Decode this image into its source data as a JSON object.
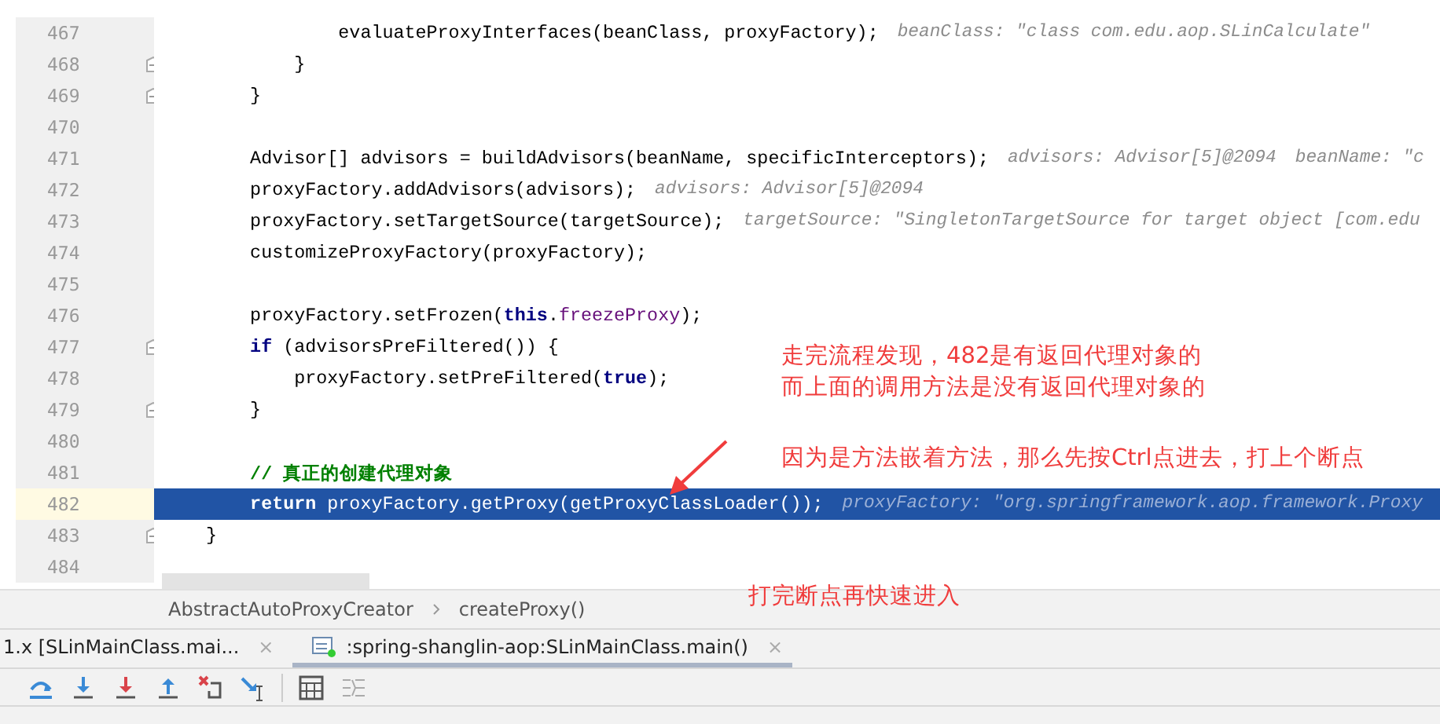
{
  "code_lines": [
    {
      "number": "467",
      "fold": false,
      "selected": false,
      "tokens": [
        {
          "text": "            evaluateProxyInterfaces(beanClass, proxyFactory);",
          "kind": "plain"
        }
      ],
      "hints": [
        "beanClass: \"class com.edu.aop.SLinCalculate\""
      ]
    },
    {
      "number": "468",
      "fold": true,
      "selected": false,
      "tokens": [
        {
          "text": "        }",
          "kind": "plain"
        }
      ]
    },
    {
      "number": "469",
      "fold": true,
      "selected": false,
      "tokens": [
        {
          "text": "    }",
          "kind": "plain"
        }
      ]
    },
    {
      "number": "470",
      "fold": false,
      "selected": false
    },
    {
      "number": "471",
      "fold": false,
      "selected": false,
      "tokens": [
        {
          "text": "    Advisor[] advisors = buildAdvisors(beanName, specificInterceptors);",
          "kind": "plain"
        }
      ],
      "hints": [
        "advisors: Advisor[5]@2094",
        "beanName: \"c"
      ]
    },
    {
      "number": "472",
      "fold": false,
      "selected": false,
      "tokens": [
        {
          "text": "    proxyFactory.addAdvisors(advisors);",
          "kind": "plain"
        }
      ],
      "hints": [
        "advisors: Advisor[5]@2094"
      ]
    },
    {
      "number": "473",
      "fold": false,
      "selected": false,
      "tokens": [
        {
          "text": "    proxyFactory.setTargetSource(targetSource);",
          "kind": "plain"
        }
      ],
      "hints": [
        "targetSource: \"SingletonTargetSource for target object [com.edu"
      ]
    },
    {
      "number": "474",
      "fold": false,
      "selected": false,
      "tokens": [
        {
          "text": "    customizeProxyFactory(proxyFactory);",
          "kind": "plain"
        }
      ]
    },
    {
      "number": "475",
      "fold": false,
      "selected": false
    },
    {
      "number": "476",
      "fold": false,
      "selected": false,
      "tokens": [
        {
          "text": "    proxyFactory.setFrozen(",
          "kind": "plain"
        },
        {
          "text": "this",
          "kind": "keyword"
        },
        {
          "text": ".",
          "kind": "plain"
        },
        {
          "text": "freezeProxy",
          "kind": "field"
        },
        {
          "text": ");",
          "kind": "plain"
        }
      ]
    },
    {
      "number": "477",
      "fold": true,
      "selected": false,
      "tokens": [
        {
          "text": "    if",
          "kind": "keyword"
        },
        {
          "text": " (advisorsPreFiltered()) {",
          "kind": "plain"
        }
      ]
    },
    {
      "number": "478",
      "fold": false,
      "selected": false,
      "tokens": [
        {
          "text": "        proxyFactory.setPreFiltered(",
          "kind": "plain"
        },
        {
          "text": "true",
          "kind": "keyword"
        },
        {
          "text": ");",
          "kind": "plain"
        }
      ]
    },
    {
      "number": "479",
      "fold": true,
      "selected": false,
      "tokens": [
        {
          "text": "    }",
          "kind": "plain"
        }
      ]
    },
    {
      "number": "480",
      "fold": false,
      "selected": false
    },
    {
      "number": "481",
      "fold": false,
      "selected": false,
      "tokens": [
        {
          "text": "    // 真正的创建代理对象",
          "kind": "comment"
        }
      ]
    },
    {
      "number": "482",
      "fold": false,
      "selected": true,
      "tokens": [
        {
          "text": "    return",
          "kind": "keyword"
        },
        {
          "text": " proxyFactory.getProxy(getProxyClassLoader());",
          "kind": "plain"
        }
      ],
      "hints": [
        "proxyFactory: \"org.springframework.aop.framework.Proxy"
      ]
    },
    {
      "number": "483",
      "fold": true,
      "selected": false,
      "tokens": [
        {
          "text": "}",
          "kind": "plain"
        }
      ]
    },
    {
      "number": "484",
      "fold": false,
      "selected": false
    }
  ],
  "breadcrumb": [
    "AbstractAutoProxyCreator",
    "createProxy()"
  ],
  "debug_tabs": [
    {
      "label": "1.x [SLinMainClass.mai...",
      "close": "×",
      "selected": false
    },
    {
      "label": ":spring-shanglin-aop:SLinMainClass.main()",
      "close": "×",
      "selected": true
    }
  ],
  "annotations": [
    "走完流程发现，482是有返回代理对象的",
    "而上面的调用方法是没有返回代理对象的",
    "因为是方法嵌着方法，那么先按Ctrl点进去，打上个断点",
    "打完断点再快速进入"
  ]
}
